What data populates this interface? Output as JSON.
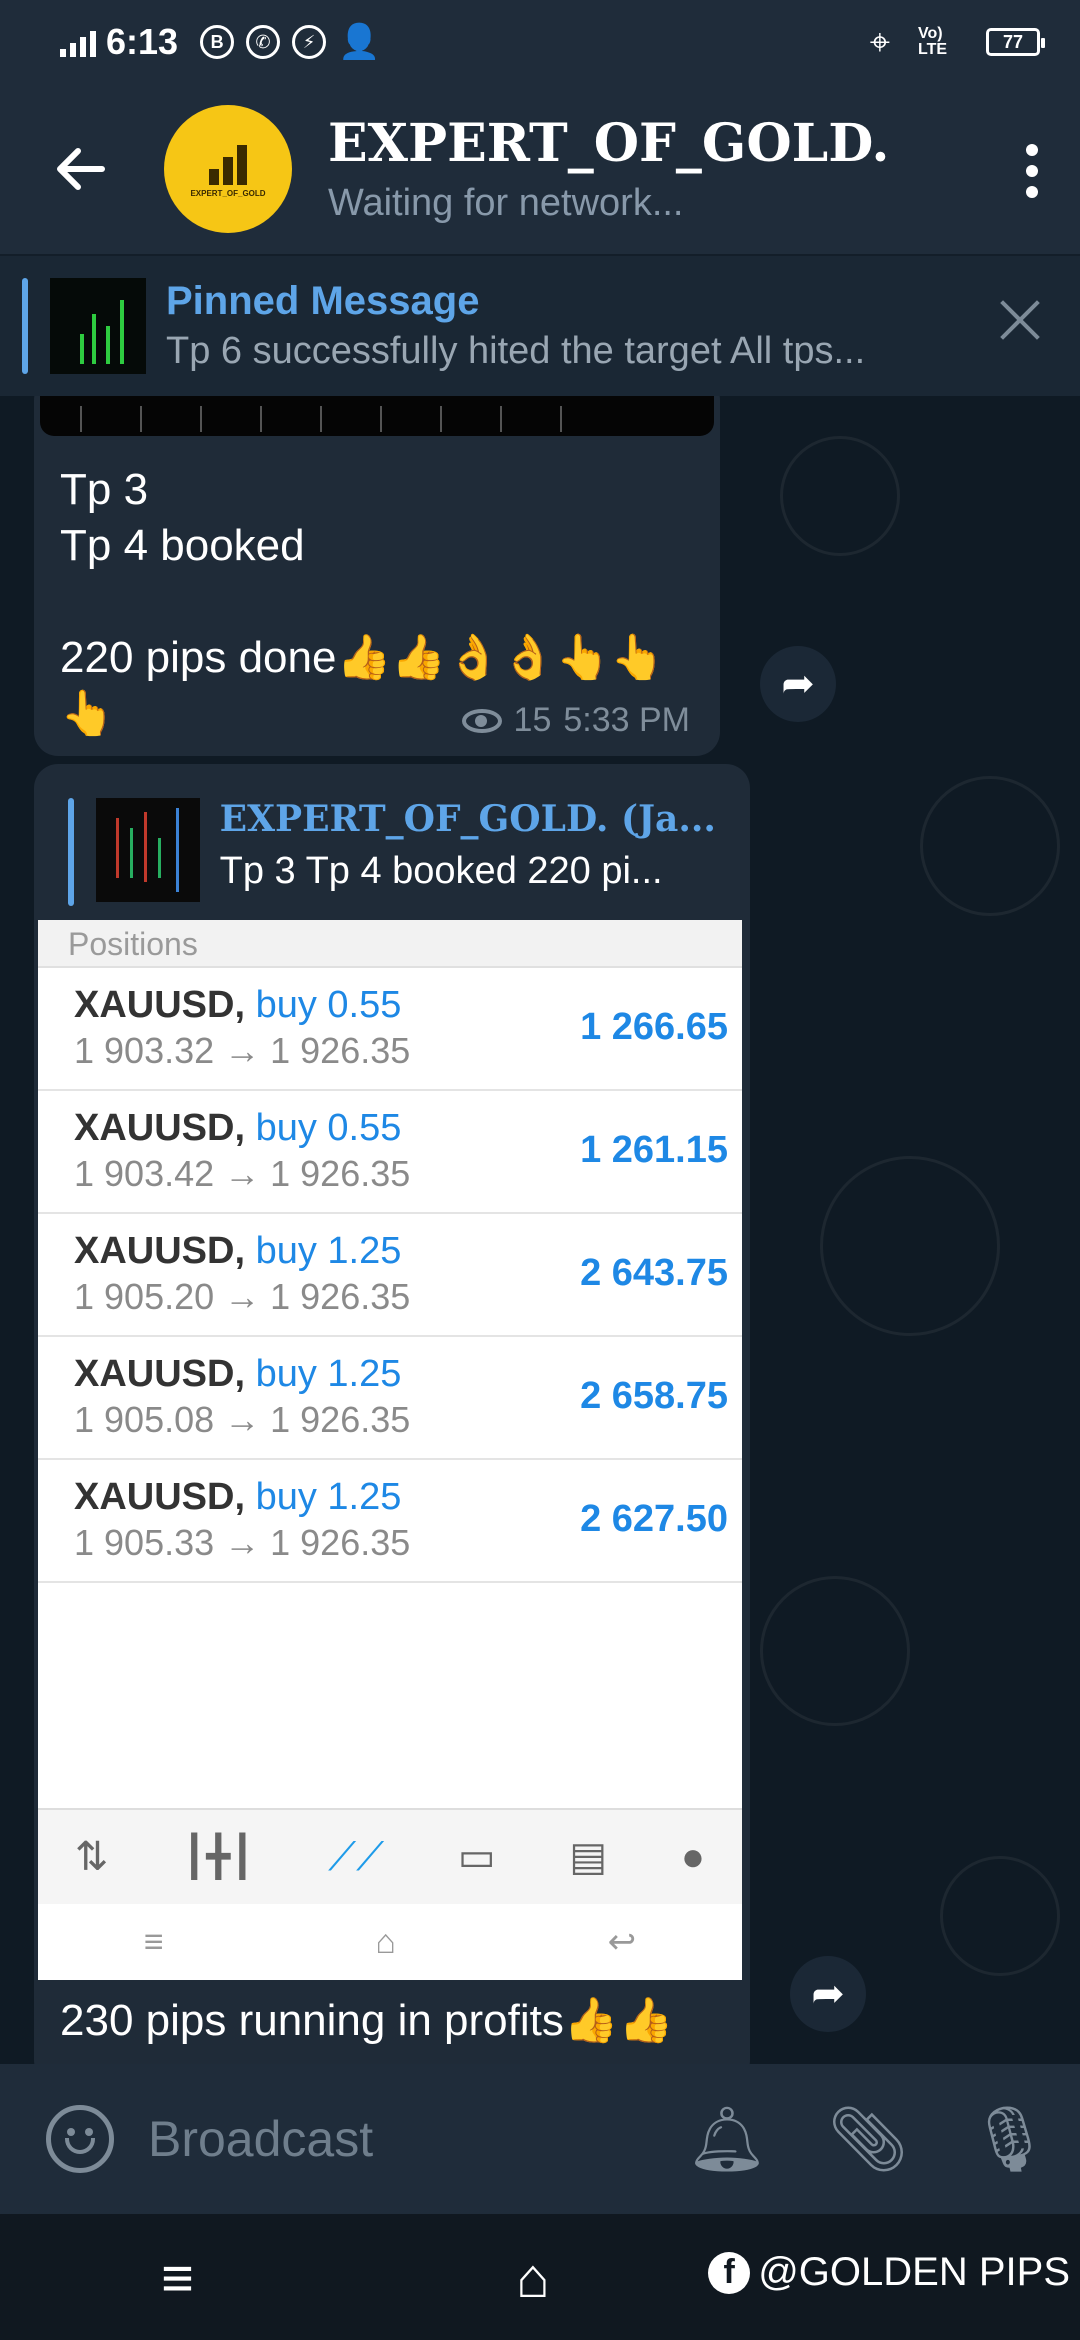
{
  "status_bar": {
    "time": "6:13",
    "battery": "77",
    "network": "Vo) LTE"
  },
  "header": {
    "title": "EXPERT_OF_GOLD.",
    "title_fade": " (Ja",
    "subtitle": "Waiting for network...",
    "avatar_text": "EXPERT_OF_GOLD"
  },
  "pinned": {
    "title": "Pinned Message",
    "message": "Tp 6 successfully hited the target  All tps..."
  },
  "messages": [
    {
      "text": "Tp 3\nTp 4 booked\n\n220 pips done👍👍👌👌👆👆\n👆",
      "views": "15",
      "time": "5:33 PM"
    },
    {
      "reply_name": "EXPERT_OF_GOLD. (Ja...",
      "reply_text": "Tp 3 Tp 4 booked  220 pi...",
      "text": "230 pips running in profits👍👍"
    }
  ],
  "positions": {
    "header": "Positions",
    "rows": [
      {
        "symbol": "XAUUSD,",
        "side": "buy 0.55",
        "price": "1 903.32 → 1 926.35",
        "profit": "1 266.65"
      },
      {
        "symbol": "XAUUSD,",
        "side": "buy 0.55",
        "price": "1 903.42 → 1 926.35",
        "profit": "1 261.15"
      },
      {
        "symbol": "XAUUSD,",
        "side": "buy 1.25",
        "price": "1 905.20 → 1 926.35",
        "profit": "2 643.75"
      },
      {
        "symbol": "XAUUSD,",
        "side": "buy 1.25",
        "price": "1 905.08 → 1 926.35",
        "profit": "2 658.75"
      },
      {
        "symbol": "XAUUSD,",
        "side": "buy 1.25",
        "price": "1 905.33 → 1 926.35",
        "profit": "2 627.50"
      }
    ]
  },
  "input": {
    "placeholder": "Broadcast"
  },
  "watermark": "@GOLDEN PIPS",
  "colors": {
    "accent": "#5ea5e8",
    "header_bg": "#1f2c3a",
    "profit_blue": "#1e88e5"
  }
}
